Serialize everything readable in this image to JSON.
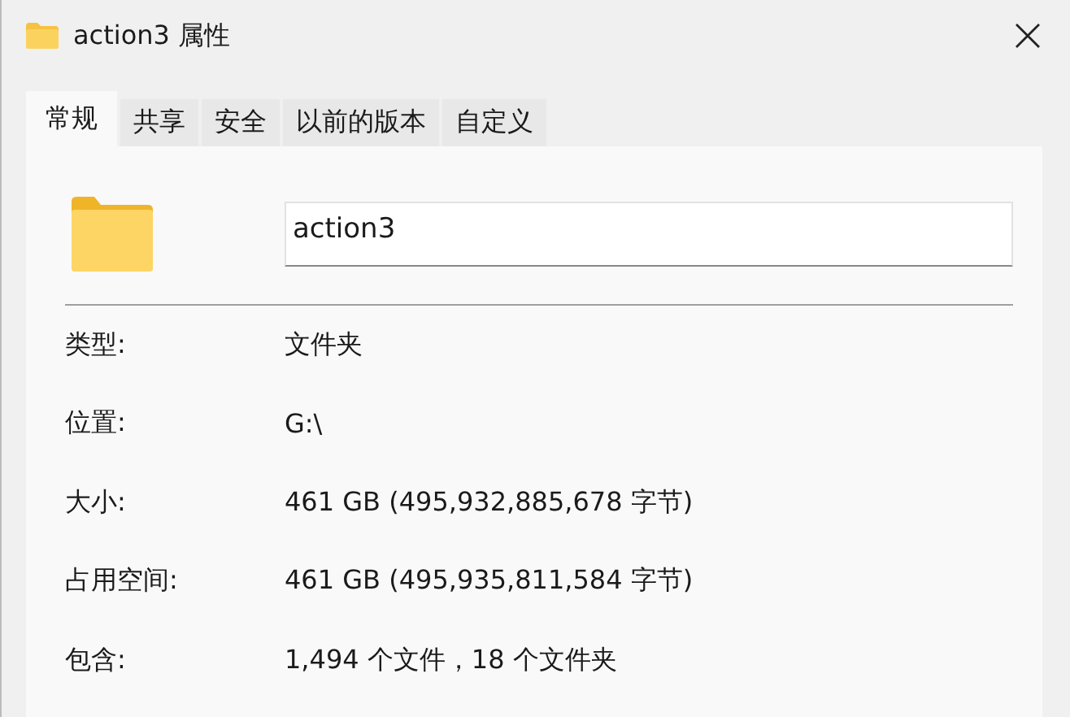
{
  "window": {
    "title": "action3 属性"
  },
  "tabs": [
    {
      "label": "常规",
      "selected": true
    },
    {
      "label": "共享",
      "selected": false
    },
    {
      "label": "安全",
      "selected": false
    },
    {
      "label": "以前的版本",
      "selected": false
    },
    {
      "label": "自定义",
      "selected": false
    }
  ],
  "name_field": {
    "value": "action3"
  },
  "properties": [
    {
      "label": "类型:",
      "value": "文件夹"
    },
    {
      "label": "位置:",
      "value": "G:\\"
    },
    {
      "label": "大小:",
      "value": "461 GB (495,932,885,678 字节)"
    },
    {
      "label": "占用空间:",
      "value": "461 GB (495,935,811,584 字节)"
    },
    {
      "label": "包含:",
      "value": "1,494 个文件，18 个文件夹"
    }
  ]
}
